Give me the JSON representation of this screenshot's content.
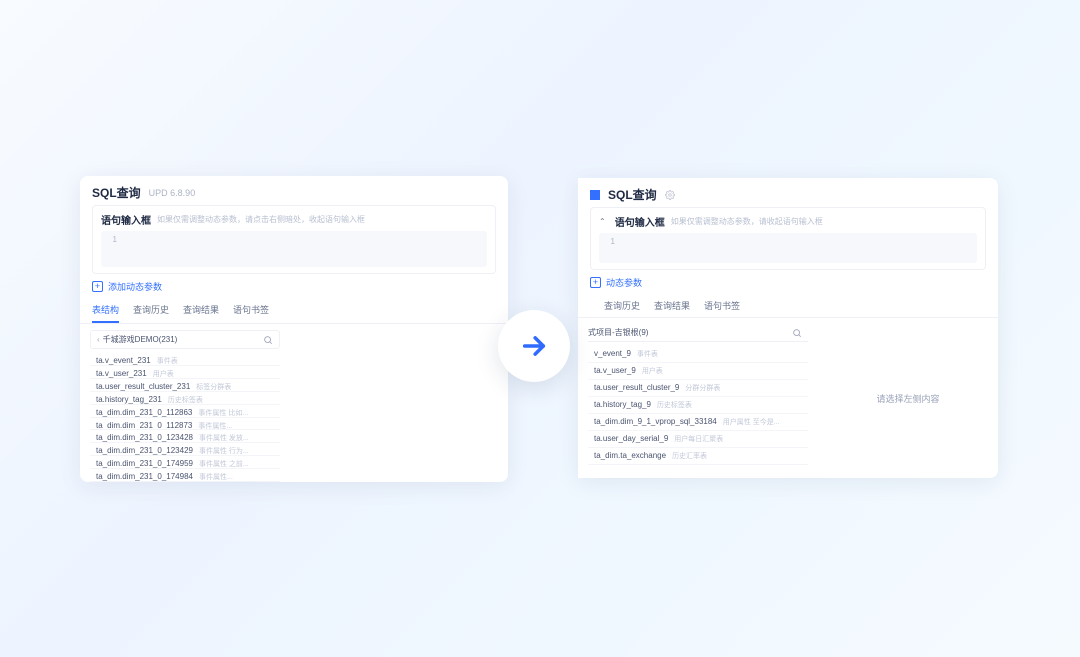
{
  "left": {
    "title": "SQL查询",
    "subtitle": "UPD 6.8.90",
    "input_label": "语句输入框",
    "input_hint": "如果仅需调整动态参数，请点击右侧暗处，收起语句输入框",
    "line_no": "1",
    "add_param": "添加动态参数",
    "tabs": [
      "表结构",
      "查询历史",
      "查询结果",
      "语句书签"
    ],
    "active_tab": 0,
    "search_label": "千城游戏DEMO(231)",
    "tables": [
      {
        "name": "ta.v_event_231",
        "desc": "事件表"
      },
      {
        "name": "ta.v_user_231",
        "desc": "用户表"
      },
      {
        "name": "ta.user_result_cluster_231",
        "desc": "标签分群表"
      },
      {
        "name": "ta.history_tag_231",
        "desc": "历史标签表"
      },
      {
        "name": "ta_dim.dim_231_0_112863",
        "desc": "事件属性 比如..."
      },
      {
        "name": "ta_dim.dim_231_0_112873",
        "desc": "事件属性..."
      },
      {
        "name": "ta_dim.dim_231_0_123428",
        "desc": "事件属性 发放..."
      },
      {
        "name": "ta_dim.dim_231_0_123429",
        "desc": "事件属性 行为..."
      },
      {
        "name": "ta_dim.dim_231_0_174959",
        "desc": "事件属性 之前..."
      },
      {
        "name": "ta_dim.dim_231_0_174984",
        "desc": "事件属性..."
      }
    ]
  },
  "right": {
    "title": "SQL查询",
    "input_label": "语句输入框",
    "input_hint": "如果仅需调整动态参数，请收起语句输入框",
    "line_no": "1",
    "add_param": "动态参数",
    "tabs": [
      "查询历史",
      "查询结果",
      "语句书签"
    ],
    "active_tab": -1,
    "search_label": "式项目-吉银根(9)",
    "tables": [
      {
        "name": "v_event_9",
        "desc": "事件表"
      },
      {
        "name": "ta.v_user_9",
        "desc": "用户表"
      },
      {
        "name": "ta.user_result_cluster_9",
        "desc": "分群分群表"
      },
      {
        "name": "ta.history_tag_9",
        "desc": "历史标签表"
      },
      {
        "name": "ta_dim.dim_9_1_vprop_sql_33184",
        "desc": "用户属性 至今是..."
      },
      {
        "name": "ta.user_day_serial_9",
        "desc": "用户每日汇聚表"
      },
      {
        "name": "ta_dim.ta_exchange",
        "desc": "历史汇率表"
      }
    ],
    "side_hint": "请选择左侧内容"
  }
}
